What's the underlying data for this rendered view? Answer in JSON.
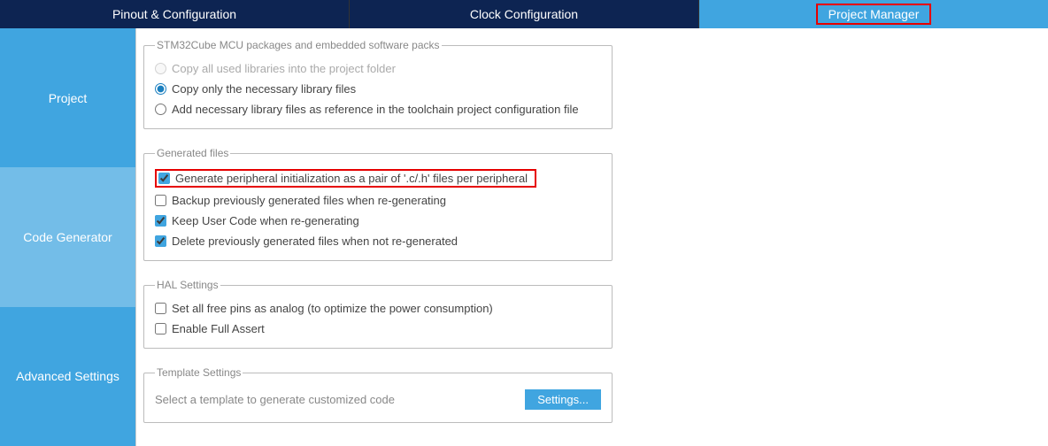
{
  "tabs": {
    "pinout": "Pinout & Configuration",
    "clock": "Clock Configuration",
    "project": "Project Manager"
  },
  "sidebar": {
    "project": "Project",
    "code_generator": "Code Generator",
    "advanced": "Advanced Settings"
  },
  "packages": {
    "legend": "STM32Cube MCU packages and embedded software packs",
    "opt_copy_all": "Copy all used libraries into the project folder",
    "opt_copy_necessary": "Copy only the necessary library files",
    "opt_reference": "Add necessary library files as reference in the toolchain project configuration file"
  },
  "generated": {
    "legend": "Generated files",
    "opt_pair": "Generate peripheral initialization as a pair of '.c/.h' files per peripheral",
    "opt_backup": "Backup previously generated files when re-generating",
    "opt_keep_user": "Keep User Code when re-generating",
    "opt_delete": "Delete previously generated files when not re-generated"
  },
  "hal": {
    "legend": "HAL Settings",
    "opt_analog": "Set all free pins as analog (to optimize the power consumption)",
    "opt_assert": "Enable Full Assert"
  },
  "template": {
    "legend": "Template Settings",
    "label": "Select a template to generate customized code",
    "button": "Settings..."
  }
}
